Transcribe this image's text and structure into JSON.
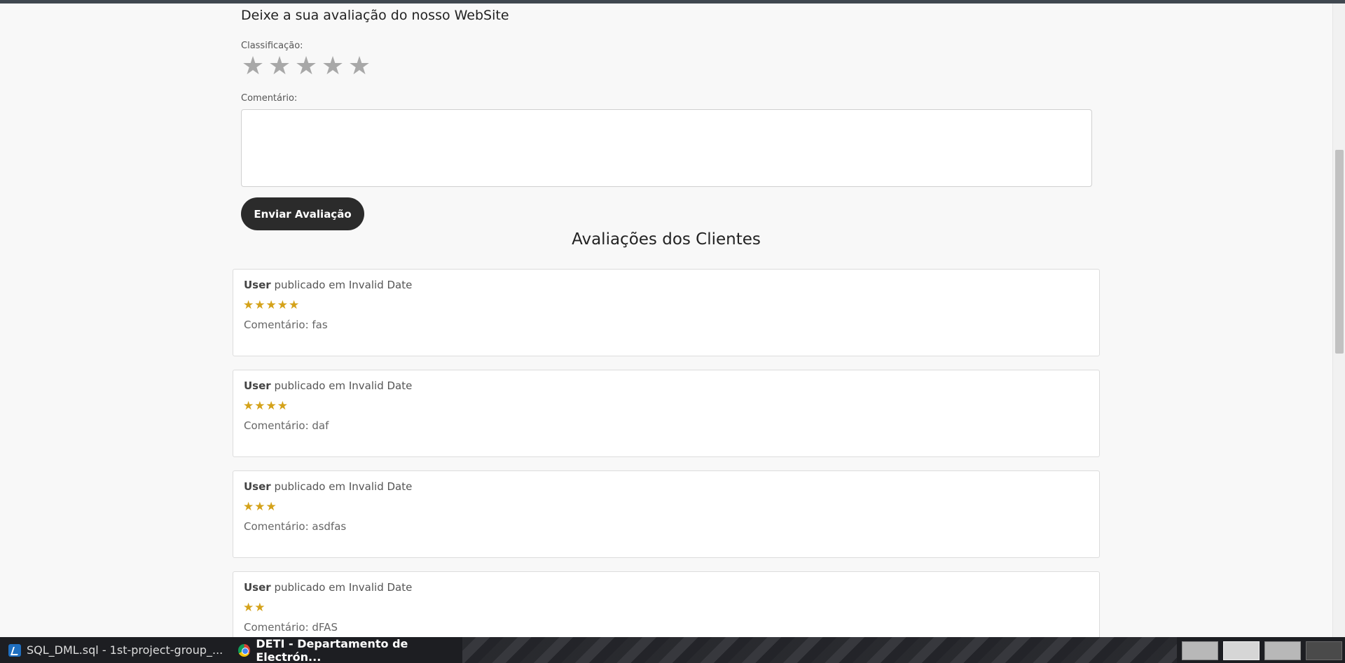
{
  "form": {
    "title": "Deixe a sua avaliação do nosso WebSite",
    "rating_label": "Classificação:",
    "rating_stars": [
      "★",
      "★",
      "★",
      "★",
      "★"
    ],
    "comment_label": "Comentário:",
    "comment_value": "",
    "submit_label": "Enviar Avaliação"
  },
  "reviews_title": "Avaliações dos Clientes",
  "reviews": [
    {
      "user": "User",
      "meta": " publicado em Invalid Date",
      "rating": 5,
      "stars": "★★★★★",
      "comment": "Comentário: fas"
    },
    {
      "user": "User",
      "meta": " publicado em Invalid Date",
      "rating": 4,
      "stars": "★★★★",
      "comment": "Comentário: daf"
    },
    {
      "user": "User",
      "meta": " publicado em Invalid Date",
      "rating": 3,
      "stars": "★★★",
      "comment": "Comentário: asdfas"
    },
    {
      "user": "User",
      "meta": " publicado em Invalid Date",
      "rating": 2,
      "stars": "★★",
      "comment": "Comentário: dFAS"
    }
  ],
  "taskbar": {
    "items": [
      {
        "label": "SQL_DML.sql - 1st-project-group_...",
        "icon": "vscode-icon"
      },
      {
        "label": "DETI - Departamento de Electrón...",
        "icon": "chrome-icon"
      }
    ]
  },
  "colors": {
    "star_filled": "#d4a21a",
    "star_empty": "#a8a8a8",
    "button_bg": "#2b2b2b"
  }
}
